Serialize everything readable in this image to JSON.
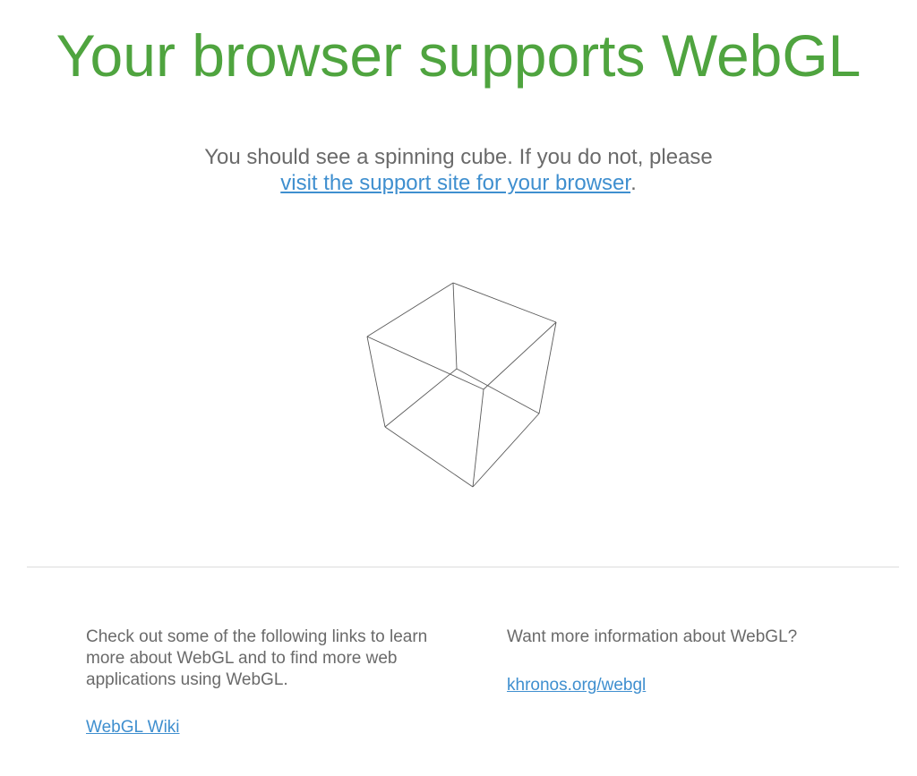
{
  "header": {
    "title": "Your browser supports WebGL"
  },
  "intro": {
    "text_before": "You should see a spinning cube. If you do not, please",
    "support_link": "visit the support site for your browser",
    "text_after": "."
  },
  "cube": {
    "name": "spinning cube",
    "edge_color": "#5a5a5a"
  },
  "footer": {
    "left": {
      "text": "Check out some of the following links to learn more about WebGL and to find more web applications using WebGL.",
      "link": "WebGL Wiki"
    },
    "right": {
      "text": "Want more information about WebGL?",
      "link": "khronos.org/webgl"
    }
  },
  "colors": {
    "title": "#4fa43f",
    "link": "#3f8fcf",
    "text": "#6a6a6a",
    "divider": "#dcdcdc"
  }
}
